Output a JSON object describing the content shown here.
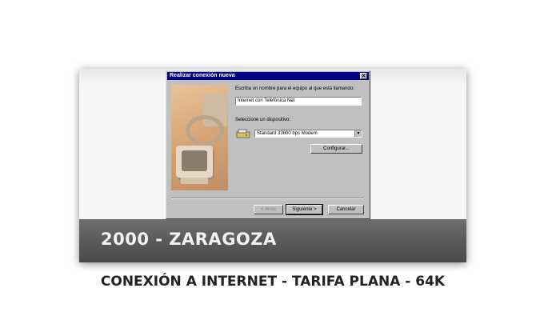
{
  "dialog": {
    "title": "Realizar conexión nueva",
    "close_glyph": "✕",
    "name_label": "Escriba un nombre para el equipo al que está llamando:",
    "name_value": "Internet con Telefónica Net",
    "device_label": "Seleccione un dispositivo:",
    "device_value": "Standard 33600 bps Modem",
    "device_icon": "modem-icon",
    "configure_label": "Configurar...",
    "back_label": "< Atrás",
    "next_label": "Siguiente >",
    "cancel_label": "Cancelar"
  },
  "banner": {
    "text": "2000 - ZARAGOZA"
  },
  "caption": {
    "text": "CONEXIÓN A INTERNET - TARIFA PLANA - 64K"
  }
}
